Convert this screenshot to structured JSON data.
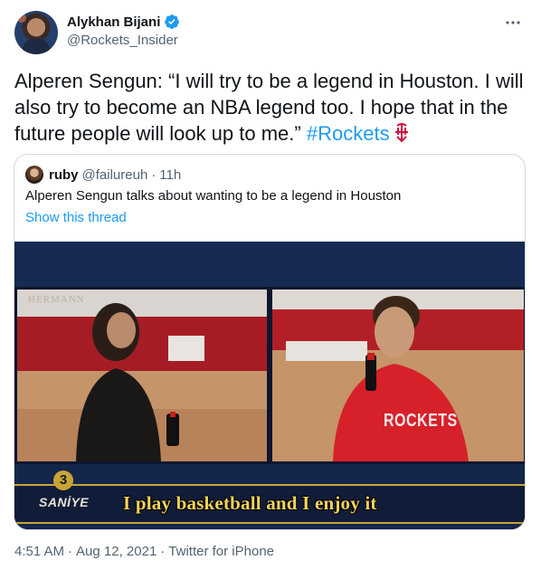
{
  "author": {
    "name": "Alykhan Bijani",
    "handle": "@Rockets_Insider",
    "verified": true
  },
  "tweet": {
    "text": "Alperen Sengun: “I will try to be a legend in Houston. I will also try to become an NBA legend too. I hope that in the future people will look up to me.”",
    "hashtag": "#Rockets",
    "hashtag_icon": "rockets-logo-icon"
  },
  "quoted_tweet": {
    "name": "ruby",
    "handle": "@failureuh",
    "separator": "·",
    "time": "11h",
    "text": "Alperen Sengun talks about wanting to be a legend in Houston",
    "show_thread": "Show this thread",
    "media": {
      "caption": "I play basketball and I enjoy it",
      "channel_number": "3",
      "channel_name": "SANİYE",
      "wall_text": "HERMANN",
      "shirt_text": "ROCKETS"
    }
  },
  "footer": {
    "time": "4:51 AM",
    "separator": "·",
    "date": "Aug 12, 2021",
    "source": "Twitter for iPhone"
  },
  "colors": {
    "accent": "#1d9bf0",
    "text": "#0f1419",
    "muted": "#536471",
    "border": "#cfd9de",
    "caption": "#f2d35a"
  }
}
